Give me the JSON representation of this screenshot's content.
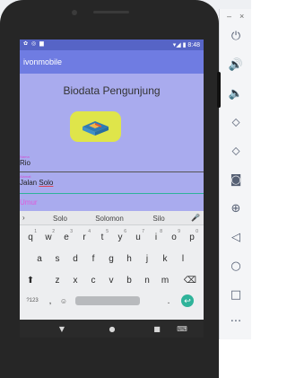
{
  "emulator_toolbar": {
    "minimize": "–",
    "close": "×",
    "buttons": [
      {
        "name": "power-icon",
        "glyph": "⏻"
      },
      {
        "name": "volume-up-icon",
        "glyph": "🔊"
      },
      {
        "name": "volume-down-icon",
        "glyph": "🔈"
      },
      {
        "name": "rotate-left-icon",
        "glyph": "⬦"
      },
      {
        "name": "rotate-right-icon",
        "glyph": "⬦"
      },
      {
        "name": "camera-icon",
        "glyph": "◙"
      },
      {
        "name": "zoom-icon",
        "glyph": "⊕"
      },
      {
        "name": "back-icon",
        "glyph": "◁"
      },
      {
        "name": "home-icon",
        "glyph": "○"
      },
      {
        "name": "overview-icon",
        "glyph": "□"
      },
      {
        "name": "more-icon",
        "glyph": "···"
      }
    ]
  },
  "status_bar": {
    "left": "✿ ◎ ▆",
    "right": "▾◢ ▮ 8:48"
  },
  "app_bar": {
    "title": "ivonmobile"
  },
  "main": {
    "heading": "Biodata Pengunjung",
    "logo_icon": "book-icon"
  },
  "fields": [
    {
      "label": "Nama",
      "value": "Rio"
    },
    {
      "label": "Alamat",
      "value_prefix": "Jalan ",
      "value_underlined": "Solo"
    },
    {
      "placeholder": "Umur"
    }
  ],
  "keyboard": {
    "suggestions": [
      "Solo",
      "Solomon",
      "Silo"
    ],
    "rows": {
      "row1": [
        "q",
        "w",
        "e",
        "r",
        "t",
        "y",
        "u",
        "i",
        "o",
        "p"
      ],
      "row1_hints": [
        "1",
        "2",
        "3",
        "4",
        "5",
        "6",
        "7",
        "8",
        "9",
        "0"
      ],
      "row2": [
        "a",
        "s",
        "d",
        "f",
        "g",
        "h",
        "j",
        "k",
        "l"
      ],
      "row3": [
        "z",
        "x",
        "c",
        "v",
        "b",
        "n",
        "m"
      ]
    },
    "symbols_key": "?123",
    "comma_key": ",",
    "period_key": ".",
    "enter_glyph": "↩"
  },
  "nav_bar": {
    "back": "▼",
    "home": "●",
    "recents": "■",
    "keyboard": "⌨"
  },
  "colors": {
    "status_bar": "#5664c6",
    "app_bar": "#6f7ce2",
    "screen_background": "#a9abee",
    "accent": "#2fb39a",
    "label": "#d24ed2",
    "logo_tile": "#dfe54a"
  }
}
